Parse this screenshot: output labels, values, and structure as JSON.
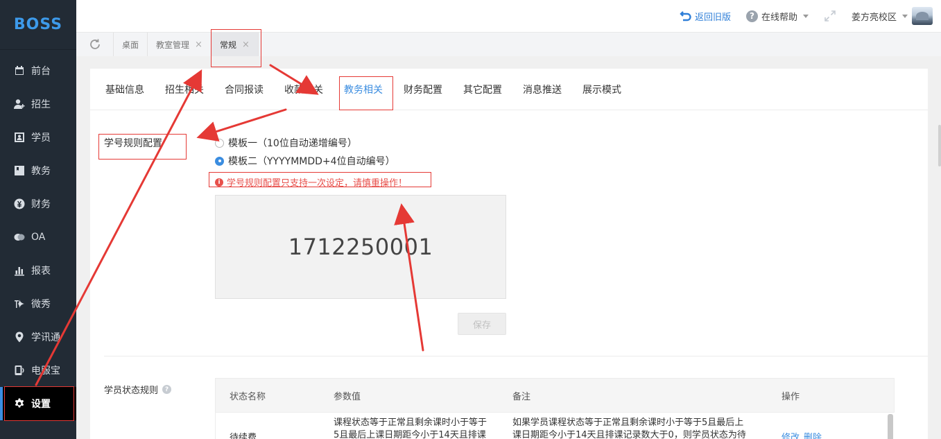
{
  "brand": {
    "logo": "BOSS",
    "accent": "#3b8de0"
  },
  "sidebar": {
    "items": [
      {
        "label": "前台",
        "icon": "calendar-icon"
      },
      {
        "label": "招生",
        "icon": "add-user-icon"
      },
      {
        "label": "学员",
        "icon": "id-card-icon"
      },
      {
        "label": "教务",
        "icon": "book-icon"
      },
      {
        "label": "财务",
        "icon": "yen-icon"
      },
      {
        "label": "OA",
        "icon": "chat-icon"
      },
      {
        "label": "报表",
        "icon": "bar-chart-icon"
      },
      {
        "label": "微秀",
        "icon": "show-icon"
      },
      {
        "label": "学讯通",
        "icon": "location-icon"
      },
      {
        "label": "电服宝",
        "icon": "phone-icon"
      },
      {
        "label": "设置",
        "icon": "gear-icon",
        "active": true
      }
    ]
  },
  "header": {
    "back_label": "返回旧版",
    "help_label": "在线帮助",
    "campus_label": "姜方亮校区"
  },
  "page_tabs": [
    {
      "label": "桌面",
      "closable": false
    },
    {
      "label": "教室管理",
      "closable": true
    },
    {
      "label": "常规",
      "closable": true,
      "current": true
    }
  ],
  "close_glyph": "×",
  "sub_tabs": [
    {
      "label": "基础信息"
    },
    {
      "label": "招生相关"
    },
    {
      "label": "合同报读"
    },
    {
      "label": "收款相关"
    },
    {
      "label": "教务相关",
      "active": true
    },
    {
      "label": "财务配置"
    },
    {
      "label": "其它配置"
    },
    {
      "label": "消息推送"
    },
    {
      "label": "展示模式"
    }
  ],
  "student_id_rule": {
    "label": "学号规则配置",
    "options": [
      {
        "label": "模板一（10位自动递增编号）",
        "selected": false
      },
      {
        "label": "模板二（YYYYMMDD+4位自动编号）",
        "selected": true
      }
    ],
    "warning": "学号规则配置只支持一次设定，请慎重操作！",
    "preview_value": "1712250001",
    "save_label": "保存"
  },
  "status_rules": {
    "label": "学员状态规则",
    "columns": [
      "状态名称",
      "参数值",
      "备注",
      "操作"
    ],
    "rows": [
      {
        "name": "待续费",
        "param_line1": "课程状态等于正常且剩余课时小于等于",
        "param_line2": "5且最后上课日期距今小于14天且排课",
        "note_line1": "如果学员课程状态等于正常且剩余课时小于等于5且最后上",
        "note_line2": "课日期距今小于14天且排课记录数大于0，则学员状态为待",
        "edit_label": "修改",
        "delete_label": "删除"
      }
    ]
  },
  "annotation_color": "#e53935"
}
